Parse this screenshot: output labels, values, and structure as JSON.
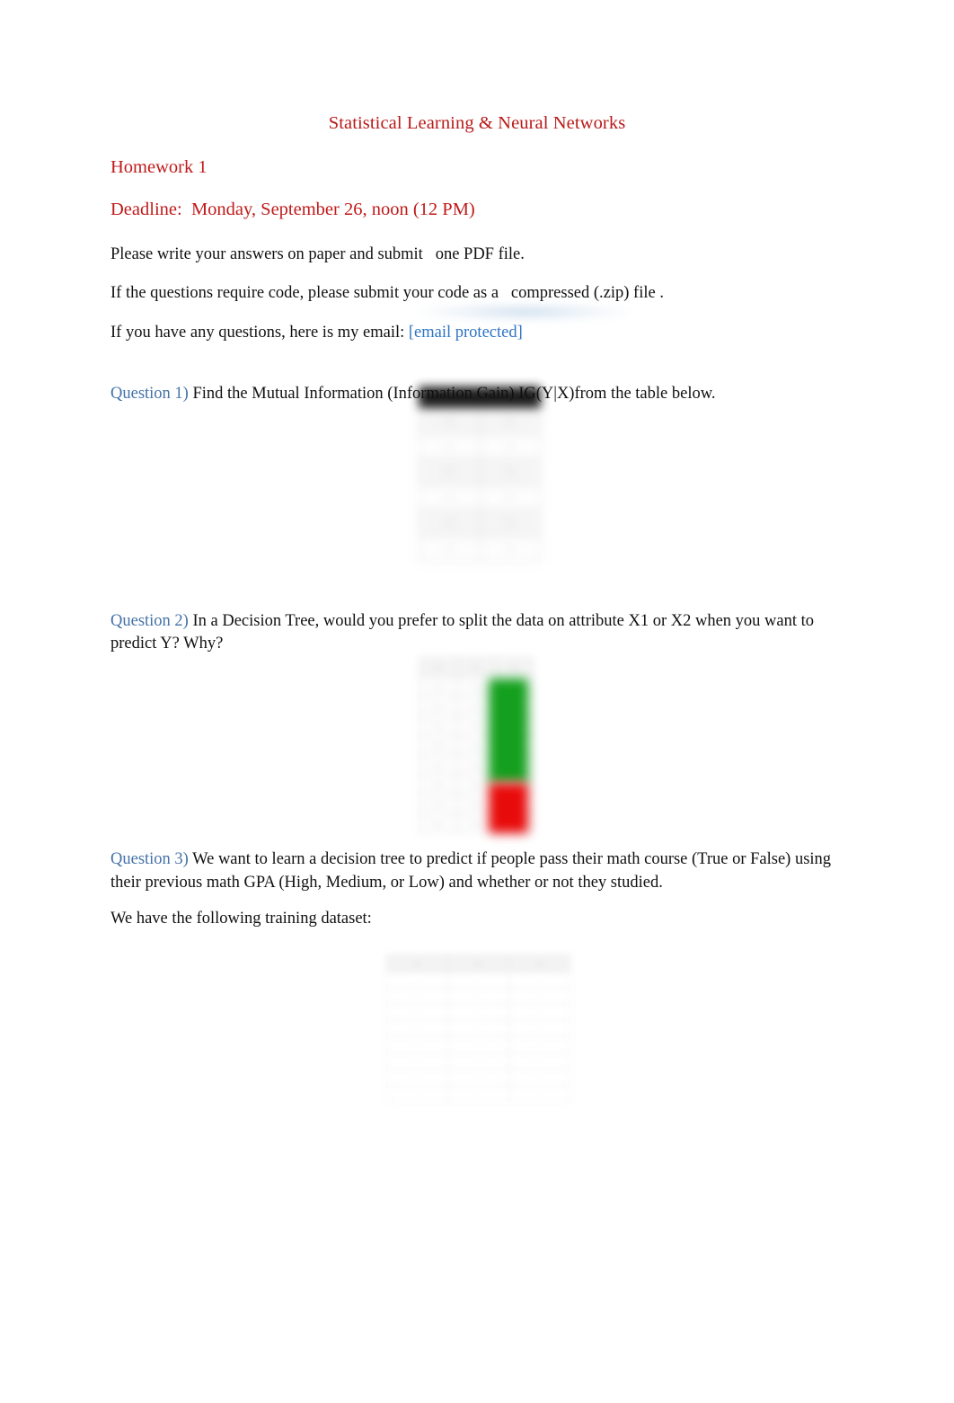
{
  "document": {
    "title": "Statistical Learning & Neural Networks",
    "heading": "Homework 1",
    "deadline": "Deadline:  Monday, September 26, noon (12 PM)",
    "instructions": [
      "Please write your answers on paper and submit   one PDF file.",
      "If the questions require code, please submit your code as a   compressed (.zip) file ."
    ],
    "email_prefix": "If you have any questions, here is my email: ",
    "email_value": "[email protected]",
    "colors": {
      "title_red": "#b81a1a",
      "heading_red": "#c01a1a",
      "question_blue": "#4472a8",
      "link_blue": "#2e74c4",
      "body_black": "#111111",
      "figure_green": "#14a01e",
      "figure_red": "#e80b0b"
    }
  },
  "questions": [
    {
      "label": "Question 1)",
      "text": " Find the Mutual Information (Information Gain) IG(Y|X)from the table below."
    },
    {
      "label": "Question 2)",
      "text": " In a Decision Tree, would you prefer to split the data on attribute X1 or X2 when you want to predict Y? Why?"
    },
    {
      "label": "Question 3)",
      "text": " We want to learn a decision tree to predict if people pass their math course (True or False) using their previous math GPA (High, Medium, or Low) and whether or not they studied."
    }
  ],
  "dataset_intro": "We have the following training dataset:",
  "figures": [
    {
      "name": "question-1-table-image",
      "description": "blurred two-column table with dark header row",
      "columns": 2,
      "body_rows": 6
    },
    {
      "name": "question-2-table-image",
      "description": "blurred table with a green-over-red highlighted column",
      "columns": 3,
      "body_rows": 8
    },
    {
      "name": "question-3-training-dataset-image",
      "description": "blurred three-column training dataset table",
      "columns": 3,
      "body_rows": 8
    }
  ]
}
